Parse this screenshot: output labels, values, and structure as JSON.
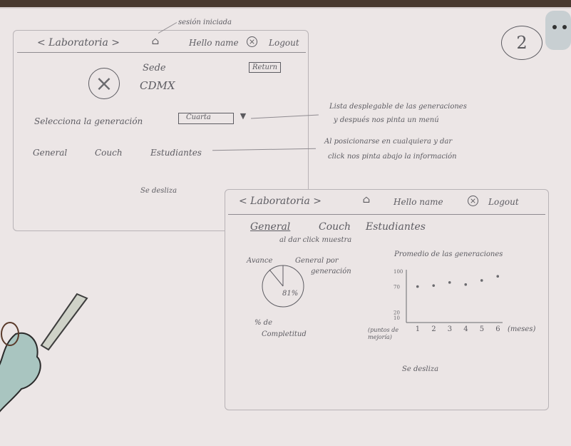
{
  "annotations": {
    "session_note": "sesión iniciada",
    "page_number": "2",
    "dropdown_note_1": "Lista desplegable de las generaciones",
    "dropdown_note_2": "y después nos pinta un menú",
    "click_note_1": "Al posicionarse en cualquiera y dar",
    "click_note_2": "click nos pinta abajo la información",
    "click_shows": "al dar click muestra"
  },
  "screen1": {
    "logo": "< Laboratoria >",
    "hello": "Hello name",
    "logout": "Logout",
    "sede_label": "Sede",
    "sede_value": "CDMX",
    "return_button": "Return",
    "select_label": "Selecciona la generación",
    "dropdown_value": "Cuarta",
    "tabs": [
      "General",
      "Couch",
      "Estudiantes"
    ],
    "scroll_hint": "Se desliza"
  },
  "screen2": {
    "logo": "< Laboratoria >",
    "hello": "Hello name",
    "logout": "Logout",
    "tabs": [
      "General",
      "Couch",
      "Estudiantes"
    ],
    "avance_label": "Avance",
    "general_por": "General por",
    "generacion": "generación",
    "pie_percent": "81%",
    "completitud_1": "% de",
    "completitud_2": "Completitud",
    "scroll_hint": "Se desliza"
  },
  "chart_data": {
    "type": "scatter",
    "title": "Promedio de las generaciones",
    "xlabel": "(meses)",
    "ylabel": "(puntos de mejoría)",
    "x_ticks": [
      "1",
      "2",
      "3",
      "4",
      "5",
      "6"
    ],
    "y_ticks": [
      "10",
      "20",
      "70",
      "100"
    ],
    "points": [
      {
        "x": 1,
        "y": 70
      },
      {
        "x": 2,
        "y": 72
      },
      {
        "x": 3,
        "y": 78
      },
      {
        "x": 4,
        "y": 74
      },
      {
        "x": 5,
        "y": 82
      },
      {
        "x": 6,
        "y": 90
      }
    ]
  }
}
